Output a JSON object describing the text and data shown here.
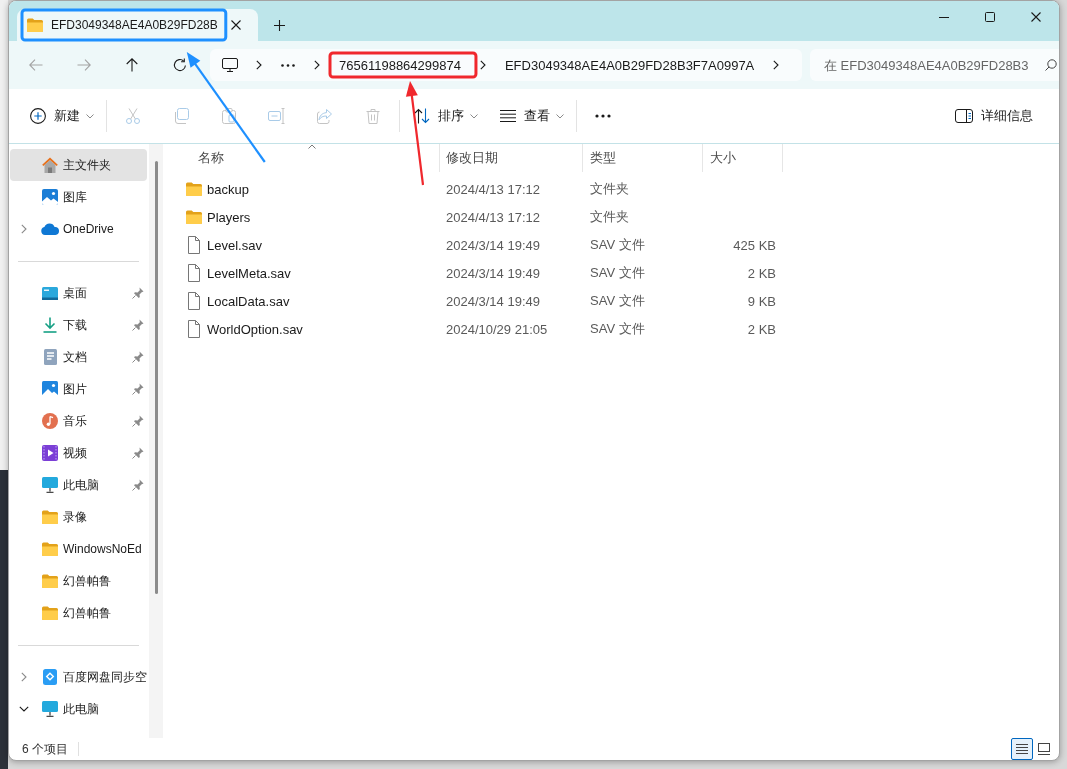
{
  "window": {
    "tabs": [
      {
        "label": "EFD3049348AE4A0B29FD28B",
        "selected": true,
        "annotation": {
          "color": "#1e90ff"
        }
      }
    ]
  },
  "navigation": [
    {
      "kind": "back",
      "disabled": true
    },
    {
      "kind": "forward",
      "disabled": true
    },
    {
      "kind": "up",
      "disabled": false
    },
    {
      "kind": "refresh",
      "disabled": false
    }
  ],
  "address_bar": {
    "segments": [
      {
        "kind": "computer"
      },
      {
        "kind": "overflow"
      },
      {
        "kind": "folder",
        "label": "76561198864299874",
        "annotation": {
          "color": "#f0282d"
        }
      },
      {
        "kind": "folder",
        "label": "EFD3049348AE4A0B29FD28B3F7A0997A"
      }
    ]
  },
  "search": {
    "placeholder": "在 EFD3049348AE4A0B29FD28B3"
  },
  "toolbar": {
    "items": [
      {
        "kind": "new",
        "label": "新建",
        "dropdown": true,
        "disabled": false
      },
      {
        "kind": "separator"
      },
      {
        "kind": "cut",
        "disabled": true
      },
      {
        "kind": "copy",
        "disabled": true
      },
      {
        "kind": "paste",
        "disabled": true
      },
      {
        "kind": "rename",
        "disabled": true
      },
      {
        "kind": "share",
        "disabled": true
      },
      {
        "kind": "delete",
        "disabled": true
      },
      {
        "kind": "separator"
      },
      {
        "kind": "sort",
        "label": "排序",
        "dropdown": true,
        "disabled": false
      },
      {
        "kind": "view",
        "label": "查看",
        "dropdown": true,
        "disabled": false
      },
      {
        "kind": "separator"
      },
      {
        "kind": "more",
        "disabled": false
      }
    ],
    "details_pane": {
      "label": "详细信息"
    }
  },
  "sidebar": {
    "items": [
      {
        "kind": "home",
        "label": "主文件夹",
        "selected": true,
        "pinned": false
      },
      {
        "kind": "gallery",
        "label": "图库",
        "selected": false,
        "pinned": false
      },
      {
        "kind": "onedrive",
        "label": "OneDrive",
        "selected": false,
        "pinned": false,
        "expanded": false
      },
      {
        "kind": "divider"
      },
      {
        "kind": "desktop",
        "label": "桌面",
        "selected": false,
        "pinned": true
      },
      {
        "kind": "downloads",
        "label": "下载",
        "selected": false,
        "pinned": true
      },
      {
        "kind": "documents",
        "label": "文档",
        "selected": false,
        "pinned": true
      },
      {
        "kind": "pictures",
        "label": "图片",
        "selected": false,
        "pinned": true
      },
      {
        "kind": "music",
        "label": "音乐",
        "selected": false,
        "pinned": true
      },
      {
        "kind": "videos",
        "label": "视频",
        "selected": false,
        "pinned": true
      },
      {
        "kind": "computer",
        "label": "此电脑",
        "selected": false,
        "pinned": true
      },
      {
        "kind": "folder",
        "label": "录像",
        "selected": false,
        "pinned": false
      },
      {
        "kind": "folder",
        "label": "WindowsNoEd",
        "selected": false,
        "pinned": false
      },
      {
        "kind": "folder",
        "label": "幻兽帕鲁",
        "selected": false,
        "pinned": false
      },
      {
        "kind": "folder",
        "label": "幻兽帕鲁",
        "selected": false,
        "pinned": false
      },
      {
        "kind": "divider"
      },
      {
        "kind": "baidu",
        "label": "百度网盘同步空",
        "selected": false,
        "pinned": false,
        "expanded": false
      },
      {
        "kind": "computer",
        "label": "此电脑",
        "selected": false,
        "pinned": false,
        "expanded": true
      }
    ]
  },
  "file_list": {
    "columns": [
      {
        "label": "名称",
        "sorted": true
      },
      {
        "label": "修改日期",
        "sorted": false
      },
      {
        "label": "类型",
        "sorted": false
      },
      {
        "label": "大小",
        "sorted": false
      }
    ],
    "rows": [
      {
        "kind": "folder",
        "name": "backup",
        "modified": "2024/4/13 17:12",
        "type": "文件夹",
        "selected": false
      },
      {
        "kind": "folder",
        "name": "Players",
        "modified": "2024/4/13 17:12",
        "type": "文件夹",
        "selected": false
      },
      {
        "kind": "file",
        "name": "Level.sav",
        "modified": "2024/3/14 19:49",
        "type": "SAV 文件",
        "size": "425 KB",
        "selected": false
      },
      {
        "kind": "file",
        "name": "LevelMeta.sav",
        "modified": "2024/3/14 19:49",
        "type": "SAV 文件",
        "size": "2 KB",
        "selected": false
      },
      {
        "kind": "file",
        "name": "LocalData.sav",
        "modified": "2024/3/14 19:49",
        "type": "SAV 文件",
        "size": "9 KB",
        "selected": false
      },
      {
        "kind": "file",
        "name": "WorldOption.sav",
        "modified": "2024/10/29 21:05",
        "type": "SAV 文件",
        "size": "2 KB",
        "selected": false
      }
    ]
  },
  "status_bar": {
    "item_count": "6 个项目",
    "views": [
      {
        "kind": "details",
        "selected": true
      },
      {
        "kind": "tiles",
        "selected": false
      }
    ]
  }
}
